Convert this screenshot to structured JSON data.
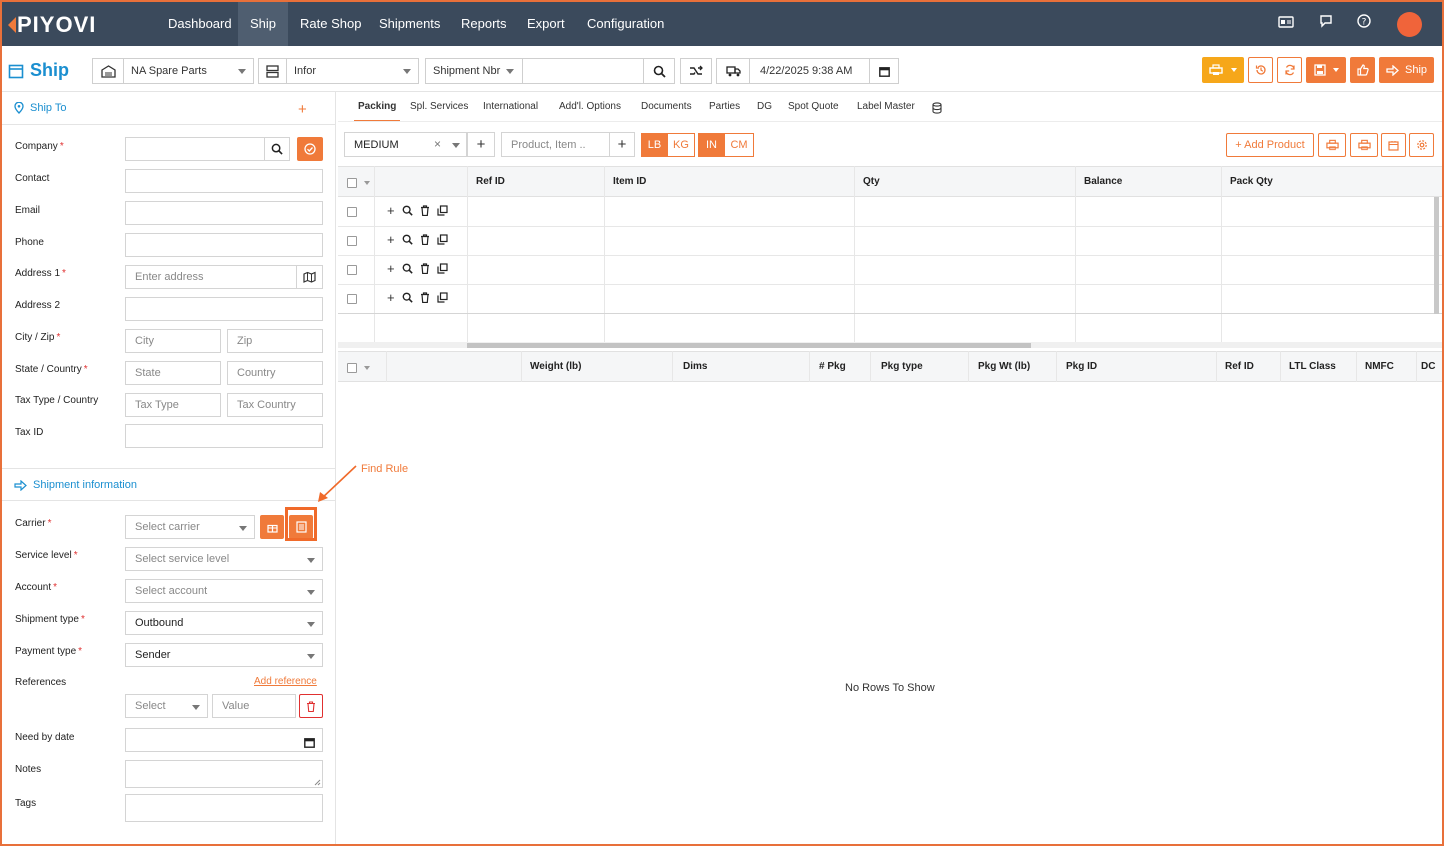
{
  "nav": {
    "logo": "PIYOVI",
    "items": [
      {
        "label": "Dashboard"
      },
      {
        "label": "Ship",
        "active": true
      },
      {
        "label": "Rate Shop"
      },
      {
        "label": "Shipments"
      },
      {
        "label": "Reports"
      },
      {
        "label": "Export"
      },
      {
        "label": "Configuration"
      }
    ],
    "icons": [
      "id-card-icon",
      "chat-icon",
      "help-icon",
      "user-avatar"
    ]
  },
  "toolbar": {
    "title": "Ship",
    "location_value": "NA Spare Parts",
    "system_value": "Infor",
    "search_type_value": "Shipment Nbr",
    "search_value": "",
    "datetime_value": "4/22/2025 9:38 AM",
    "ship_label": "Ship"
  },
  "ship_to": {
    "heading": "Ship To",
    "fields": {
      "company": {
        "label": "Company",
        "required": true,
        "placeholder": ""
      },
      "contact": {
        "label": "Contact",
        "required": false
      },
      "email": {
        "label": "Email",
        "required": false
      },
      "phone": {
        "label": "Phone",
        "required": false
      },
      "address1": {
        "label": "Address 1",
        "required": true,
        "placeholder": "Enter address"
      },
      "address2": {
        "label": "Address 2",
        "required": false
      },
      "city_zip": {
        "label": "City / Zip",
        "required": true,
        "city_placeholder": "City",
        "zip_placeholder": "Zip"
      },
      "state_country": {
        "label": "State / Country",
        "required": true,
        "state_placeholder": "State",
        "country_placeholder": "Country"
      },
      "tax_type_country": {
        "label": "Tax Type / Country",
        "required": false,
        "type_placeholder": "Tax Type",
        "country_placeholder": "Tax Country"
      },
      "tax_id": {
        "label": "Tax ID",
        "required": false
      }
    }
  },
  "shipment_info": {
    "heading": "Shipment information",
    "carrier": {
      "label": "Carrier",
      "placeholder": "Select carrier"
    },
    "service_level": {
      "label": "Service level",
      "placeholder": "Select service level"
    },
    "account": {
      "label": "Account",
      "placeholder": "Select account"
    },
    "shipment_type": {
      "label": "Shipment type",
      "value": "Outbound"
    },
    "payment_type": {
      "label": "Payment type",
      "value": "Sender"
    },
    "references": {
      "label": "References",
      "add_link": "Add reference",
      "select_placeholder": "Select",
      "value_placeholder": "Value"
    },
    "need_by_date": {
      "label": "Need by date"
    },
    "notes": {
      "label": "Notes"
    },
    "tags": {
      "label": "Tags"
    }
  },
  "annotation": {
    "label": "Find Rule"
  },
  "tabs": [
    {
      "label": "Packing",
      "active": true
    },
    {
      "label": "Spl. Services"
    },
    {
      "label": "International"
    },
    {
      "label": "Add'l. Options"
    },
    {
      "label": "Documents"
    },
    {
      "label": "Parties"
    },
    {
      "label": "DG"
    },
    {
      "label": "Spot Quote"
    },
    {
      "label": "Label Master"
    }
  ],
  "packing": {
    "package_value": "MEDIUM",
    "product_placeholder": "Product, Item ..",
    "unit_weight": [
      "LB",
      "KG"
    ],
    "unit_dim": [
      "IN",
      "CM"
    ],
    "add_product": "+ Add Product",
    "items_grid": {
      "columns": [
        "Ref ID",
        "Item ID",
        "Qty",
        "Balance",
        "Pack Qty"
      ],
      "row_count": 4
    },
    "packages_grid": {
      "columns": [
        "Weight (lb)",
        "Dims",
        "# Pkg",
        "Pkg type",
        "Pkg Wt (lb)",
        "Pkg ID",
        "Ref ID",
        "LTL Class",
        "NMFC",
        "DC"
      ],
      "empty_text": "No Rows To Show"
    }
  },
  "colors": {
    "nav_bg": "#3b4a5c",
    "accent": "#f07a3a",
    "link": "#1b8fd0",
    "print_button": "#f6a71a"
  }
}
